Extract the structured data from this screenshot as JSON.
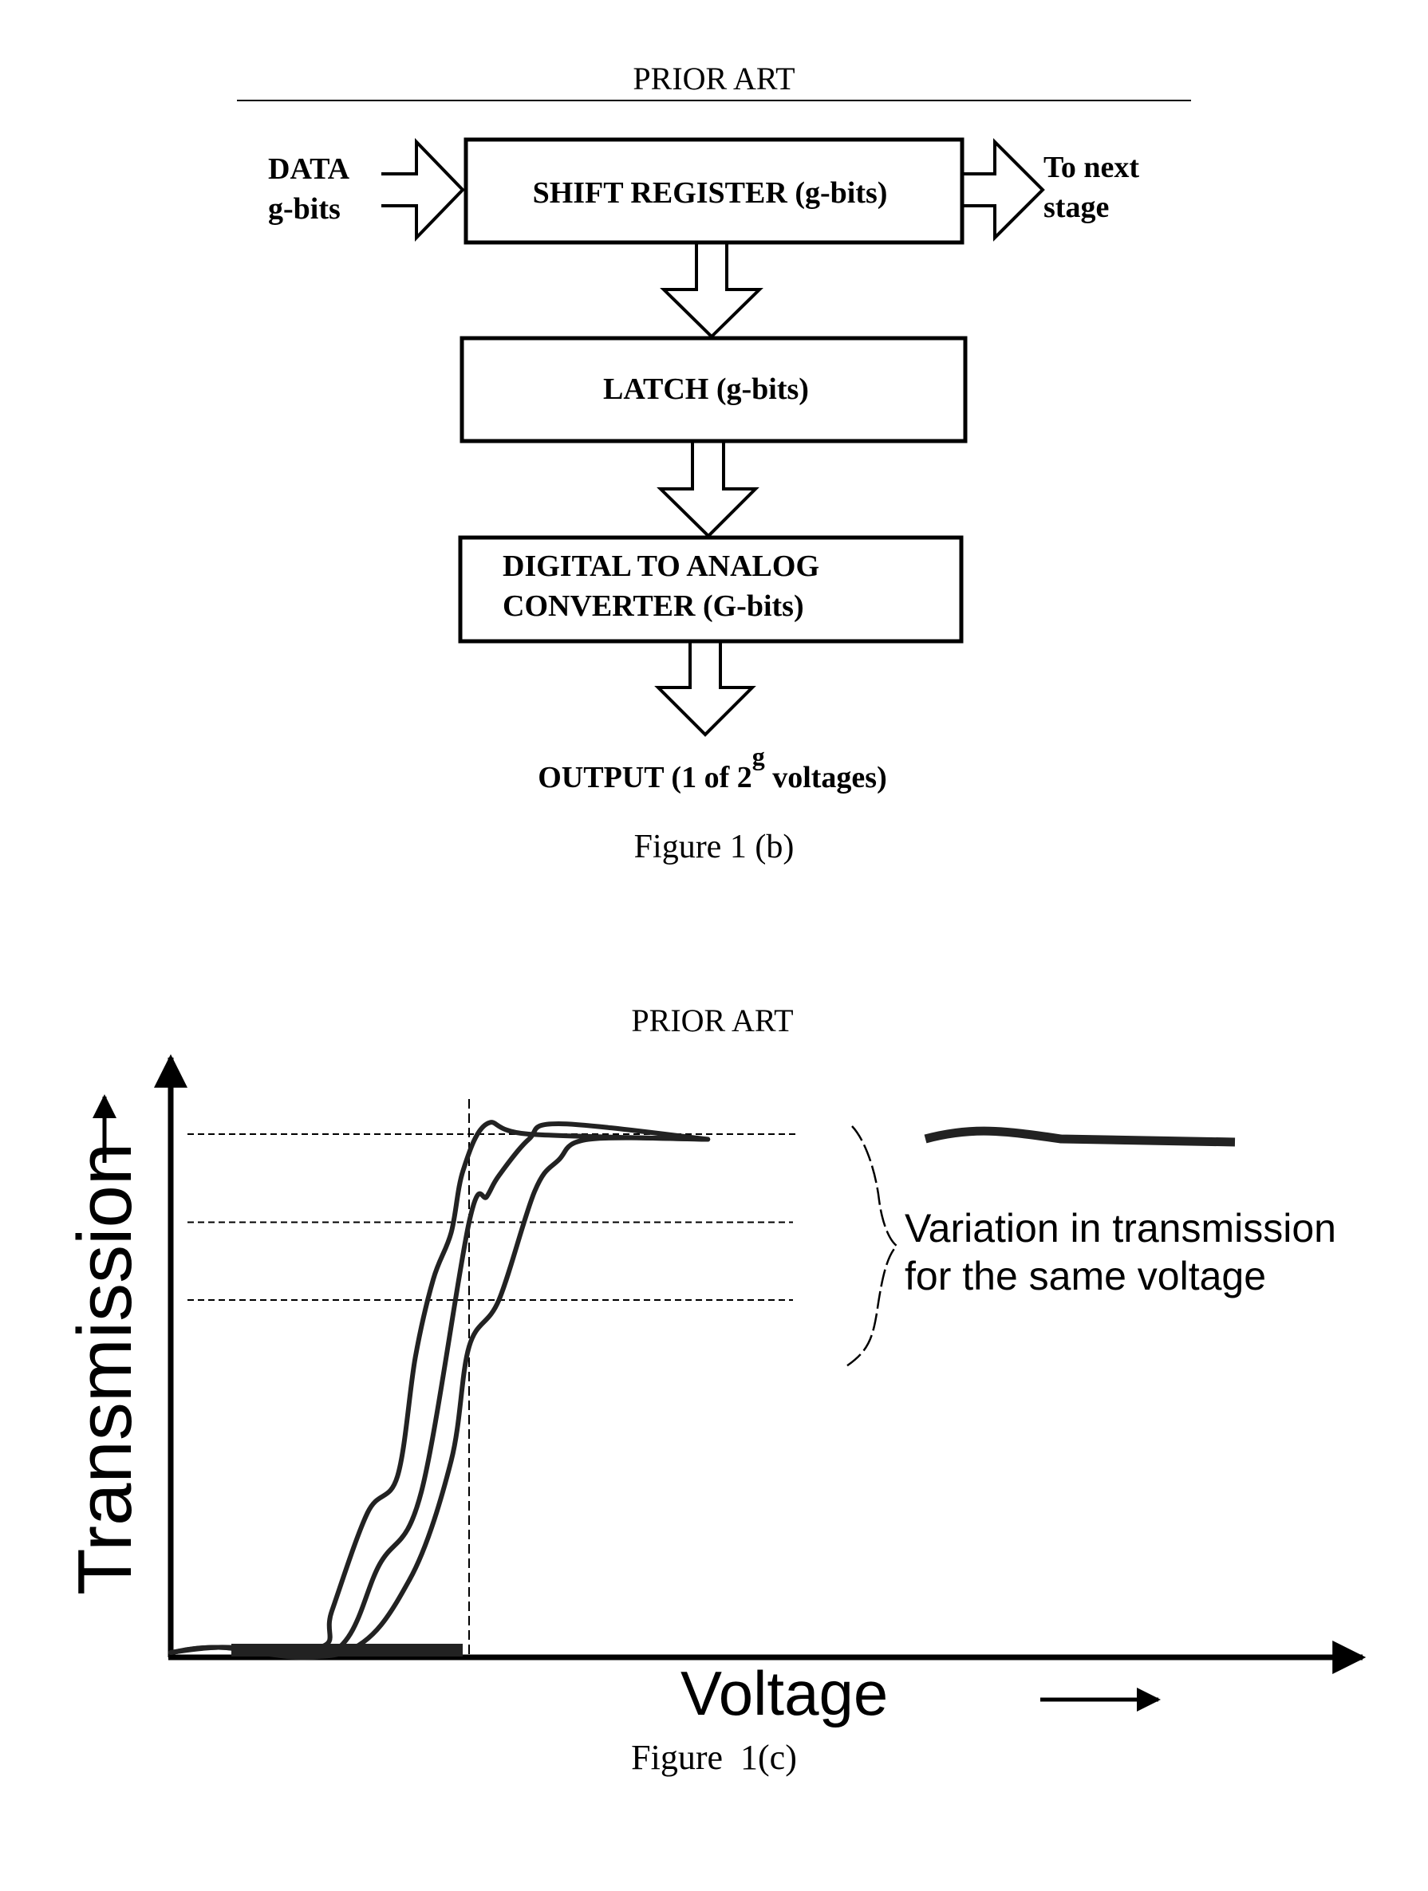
{
  "figure_b": {
    "header": "PRIOR ART",
    "input_label_line1": "DATA",
    "input_label_line2": "g-bits",
    "output_label_line1": "To next",
    "output_label_line2": "stage",
    "blocks": [
      {
        "id": "shift-register",
        "lines": [
          "SHIFT REGISTER (g-bits)"
        ]
      },
      {
        "id": "latch",
        "lines": [
          "LATCH (g-bits)"
        ]
      },
      {
        "id": "dac",
        "lines": [
          "DIGITAL TO ANALOG",
          "CONVERTER (G-bits)"
        ]
      }
    ],
    "output_text_pre": "OUTPUT (1 of 2",
    "output_text_sup": "g",
    "output_text_post": " voltages)",
    "caption": "Figure 1 (b)"
  },
  "figure_c": {
    "header": "PRIOR ART",
    "caption": "Figure  1(c)"
  },
  "chart_data": {
    "type": "line",
    "title": "PRIOR ART",
    "xlabel": "Voltage",
    "ylabel": "Transmission",
    "xlim": [
      0,
      100
    ],
    "ylim": [
      0,
      100
    ],
    "grid": false,
    "legend": "none",
    "annotation": {
      "line1": "Variation in transmission",
      "line2": "for the same voltage"
    },
    "reference_lines": {
      "vertical_x": 50,
      "horizontal_y": [
        100,
        83,
        68
      ]
    },
    "series": [
      {
        "name": "curve-1",
        "x": [
          0,
          8,
          25,
          27,
          33,
          38,
          41,
          44,
          47,
          49,
          53,
          60,
          90
        ],
        "y": [
          0,
          1,
          1,
          8,
          27,
          34,
          57,
          72,
          81,
          93,
          102,
          100,
          99
        ]
      },
      {
        "name": "curve-2",
        "x": [
          0,
          8,
          27,
          35,
          42,
          50,
          53,
          55,
          60,
          65,
          90
        ],
        "y": [
          0,
          1,
          0,
          17,
          31,
          83,
          88,
          92,
          99,
          102,
          99
        ]
      },
      {
        "name": "curve-3",
        "x": [
          0,
          8,
          29,
          40,
          47,
          50,
          55,
          61,
          65,
          70,
          90
        ],
        "y": [
          0,
          1,
          0,
          14,
          37,
          59,
          68,
          89,
          95,
          99,
          99
        ]
      }
    ]
  }
}
